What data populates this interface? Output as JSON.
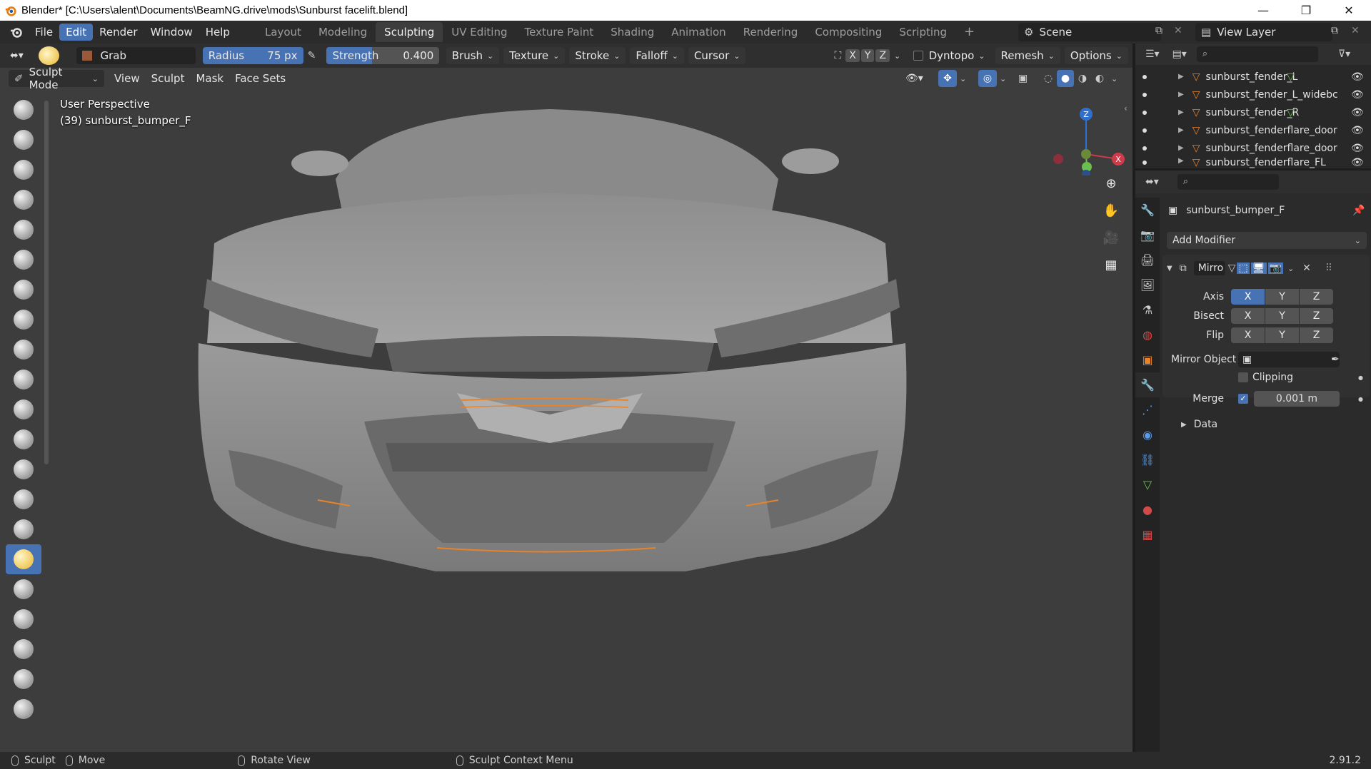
{
  "window": {
    "title": "Blender* [C:\\Users\\alent\\Documents\\BeamNG.drive\\mods\\Sunburst facelift.blend]",
    "minimize": "—",
    "maximize": "❐",
    "close": "✕"
  },
  "menu": {
    "items": [
      "File",
      "Edit",
      "Render",
      "Window",
      "Help"
    ],
    "active": "Edit"
  },
  "workspaces": {
    "tabs": [
      "Layout",
      "Modeling",
      "Sculpting",
      "UV Editing",
      "Texture Paint",
      "Shading",
      "Animation",
      "Rendering",
      "Compositing",
      "Scripting"
    ],
    "active": "Sculpting",
    "add": "+"
  },
  "scene": {
    "label": "Scene"
  },
  "view_layer": {
    "label": "View Layer"
  },
  "tool_header": {
    "brush_name": "Grab",
    "radius_label": "Radius",
    "radius_value": "75 px",
    "strength_label": "Strength",
    "strength_value": "0.400",
    "strength_fraction": 0.4,
    "dropdowns": [
      "Brush",
      "Texture",
      "Stroke",
      "Falloff",
      "Cursor"
    ],
    "axes": [
      "X",
      "Y",
      "Z"
    ],
    "dyntopo": "Dyntopo",
    "remesh": "Remesh",
    "options": "Options"
  },
  "header2": {
    "mode": "Sculpt Mode",
    "menus": [
      "View",
      "Sculpt",
      "Mask",
      "Face Sets"
    ]
  },
  "viewport": {
    "perspective": "User Perspective",
    "object": "(39) sunburst_bumper_F",
    "gizmo": {
      "z": "Z",
      "x": "X"
    }
  },
  "outliner": {
    "items": [
      "sunburst_fender_L",
      "sunburst_fender_L_widebc",
      "sunburst_fender_R",
      "sunburst_fenderflare_door",
      "sunburst_fenderflare_door",
      "sunburst_fenderflare_FL"
    ]
  },
  "properties": {
    "object_name": "sunburst_bumper_F",
    "add_modifier": "Add Modifier",
    "modifier_name": "Mirro",
    "axis_label": "Axis",
    "bisect_label": "Bisect",
    "flip_label": "Flip",
    "axis_letters": [
      "X",
      "Y",
      "Z"
    ],
    "mirror_object_label": "Mirror Object",
    "clipping_label": "Clipping",
    "merge_label": "Merge",
    "merge_value": "0.001 m",
    "data_label": "Data"
  },
  "statusbar": {
    "items": [
      "Sculpt",
      "Move",
      "Rotate View",
      "Sculpt Context Menu"
    ],
    "version": "2.91.2"
  },
  "colors": {
    "accent": "#4772b3",
    "viewport_bg": "#3d3d3d",
    "panel_bg": "#2b2b2b",
    "mesh": "#8a8a8a",
    "selection_edge": "#e8832a"
  }
}
